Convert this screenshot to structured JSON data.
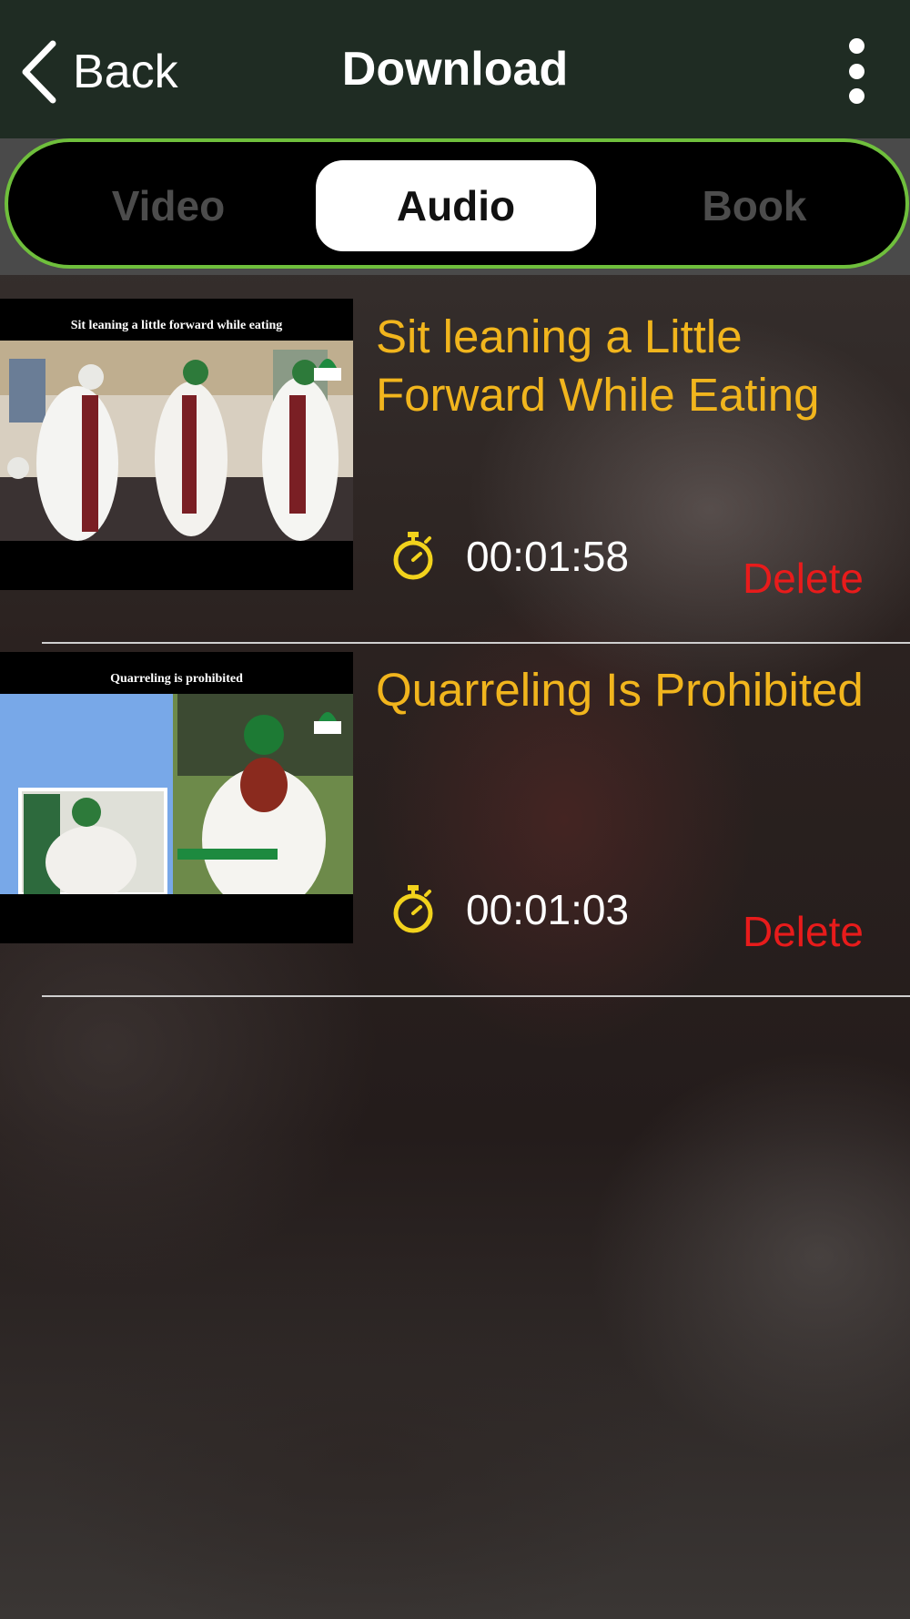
{
  "navbar": {
    "back_label": "Back",
    "title": "Download",
    "more_icon": "more-vertical-icon"
  },
  "tabs": [
    {
      "label": "Video",
      "active": false
    },
    {
      "label": "Audio",
      "active": true
    },
    {
      "label": "Book",
      "active": false
    }
  ],
  "items": [
    {
      "thumbnail_caption": "Sit leaning a little forward while eating",
      "title": "Sit leaning a Little Forward While Eating",
      "duration": "00:01:58",
      "delete_label": "Delete"
    },
    {
      "thumbnail_caption": "Quarreling is prohibited",
      "title": "Quarreling Is Prohibited",
      "duration": "00:01:03",
      "delete_label": "Delete"
    }
  ],
  "colors": {
    "navbar_bg": "#1f2c23",
    "segment_border": "#6fbf3c",
    "title_color": "#f1b51d",
    "delete_color": "#e81b1b",
    "timer_icon": "#f2d21c"
  }
}
